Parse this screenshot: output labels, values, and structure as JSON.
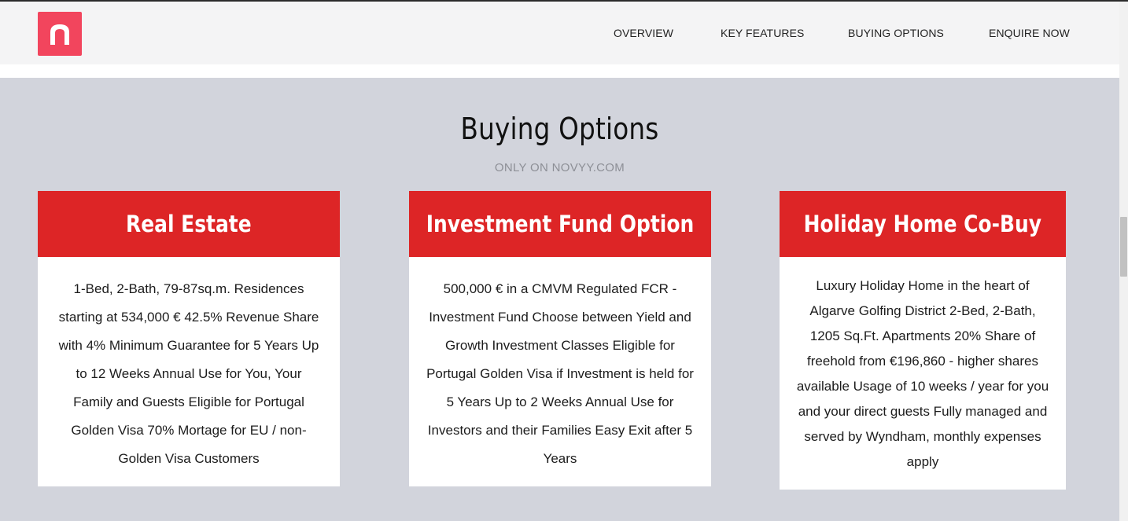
{
  "colors": {
    "brand": "#f2455d",
    "card_header": "#dd2526",
    "page_background": "#d2d4dc",
    "header_background": "#f4f4f5"
  },
  "logo": {
    "icon": "novyy-n-logo-icon"
  },
  "nav": {
    "items": [
      {
        "label": "OVERVIEW"
      },
      {
        "label": "KEY FEATURES"
      },
      {
        "label": "BUYING OPTIONS"
      },
      {
        "label": "ENQUIRE NOW"
      }
    ]
  },
  "section": {
    "title": "Buying Options",
    "subtitle": "ONLY ON NOVYY.COM"
  },
  "cards": [
    {
      "title": "Real Estate",
      "body": "1-Bed, 2-Bath, 79-87sq.m. Residences starting at 534,000 € 42.5% Revenue Share with 4% Minimum Guarantee for 5 Years Up to 12 Weeks Annual Use for You, Your Family and Guests Eligible for Portugal Golden Visa 70% Mortage for EU / non-Golden Visa Customers"
    },
    {
      "title": "Investment Fund Option",
      "body": "500,000 € in a CMVM Regulated FCR - Investment Fund Choose between Yield and Growth Investment Classes Eligible for Portugal Golden Visa if Investment is held for 5 Years Up to 2 Weeks Annual Use for Investors and their Families Easy Exit after 5 Years"
    },
    {
      "title": "Holiday Home Co-Buy",
      "body": "Luxury Holiday Home in the heart of Algarve Golfing District 2-Bed, 2-Bath, 1205 Sq.Ft. Apartments 20% Share of freehold from €196,860 - higher shares available Usage of 10 weeks / year for you and your direct guests Fully managed and served by Wyndham, monthly expenses apply"
    }
  ]
}
